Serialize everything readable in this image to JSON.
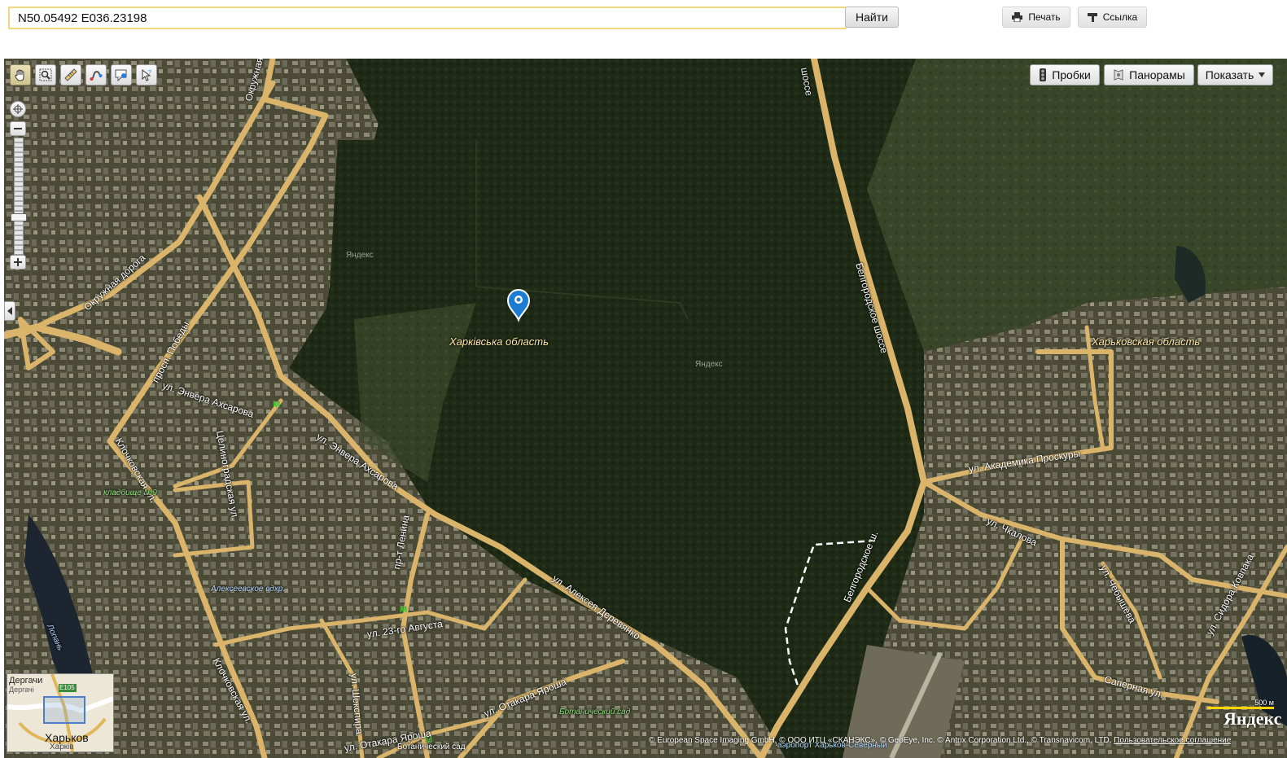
{
  "search": {
    "value": "N50.05492 E036.23198",
    "find_label": "Найти"
  },
  "toolbar": {
    "print_label": "Печать",
    "link_label": "Ссылка"
  },
  "map_controls": {
    "traffic_label": "Пробки",
    "panoramas_label": "Панорамы",
    "show_label": "Показать",
    "tools": [
      "hand-icon",
      "magnifier-zoom-icon",
      "ruler-icon",
      "route-icon",
      "feedback-icon",
      "pointer-help-icon"
    ]
  },
  "labels": {
    "okruzhnaya_top": "Окружная",
    "okruzhnaya_doroga": "Окружная дорога",
    "prosp_pobedy": "просп. Победы",
    "enver_1": "ул. Энвера Ахсарова",
    "enver_2": "ул. Энвера Ахсарова",
    "klochkovskaya_1": "Клочковская ул.",
    "klochkovskaya_2": "Клочковская ул.",
    "tselinograd": "Целиноградская ул.",
    "kladbishche": "кладбище №9",
    "alekseevskoe": "Алексеевское вдхр.",
    "lopan": "Лопань",
    "pr_lenina": "пр-т Ленина",
    "avgusta": "ул. 23-го Августа",
    "shekspira": "ул. Шекспира",
    "otakara_1": "ул. Отакара Яроша",
    "otakara_2": "ул. Отакара Яроша",
    "derevyanko": "ул. Алексея Деревянко",
    "botanical_garden": "Ботанический сад",
    "botanical_sad": "Ботанический сад",
    "belgorod_1": "Белгородское шоссе",
    "belgorod_2": "Белгородское ш.",
    "akad_proskury": "ул. Академика Проскуры",
    "chkalova": "ул. Чкалова",
    "chebysheva": "ул. Чебышева",
    "sapernaya": "Саперная ул.",
    "sidora": "ул. Сидора Ковпака",
    "kharkivska": "Харківська область",
    "kharkovskaya": "Харьковская область",
    "yandex_wm1": "Яндекс",
    "yandex_wm2": "Яндекс",
    "highway_top": "шоссе"
  },
  "minimap": {
    "city": "Харьков",
    "city_ua": "Харків",
    "town": "Дергачи",
    "town_ua": "Дергачі",
    "road": "E105"
  },
  "scale_label": "500 м",
  "logo": "Яндекс",
  "airport": "аэропорт Харьков-Северный",
  "copyright": "© European Space Imaging GmbH, © ООО ИТЦ «СКАНЭКС», © GeoEye, Inc. © Antrix Corporation Ltd., © Transnavicom, LTD.",
  "terms": "Пользовательское соглашение",
  "colors": {
    "road": "#d9b46a",
    "forest": "#1f2b17",
    "accent": "#1e7bd4"
  }
}
